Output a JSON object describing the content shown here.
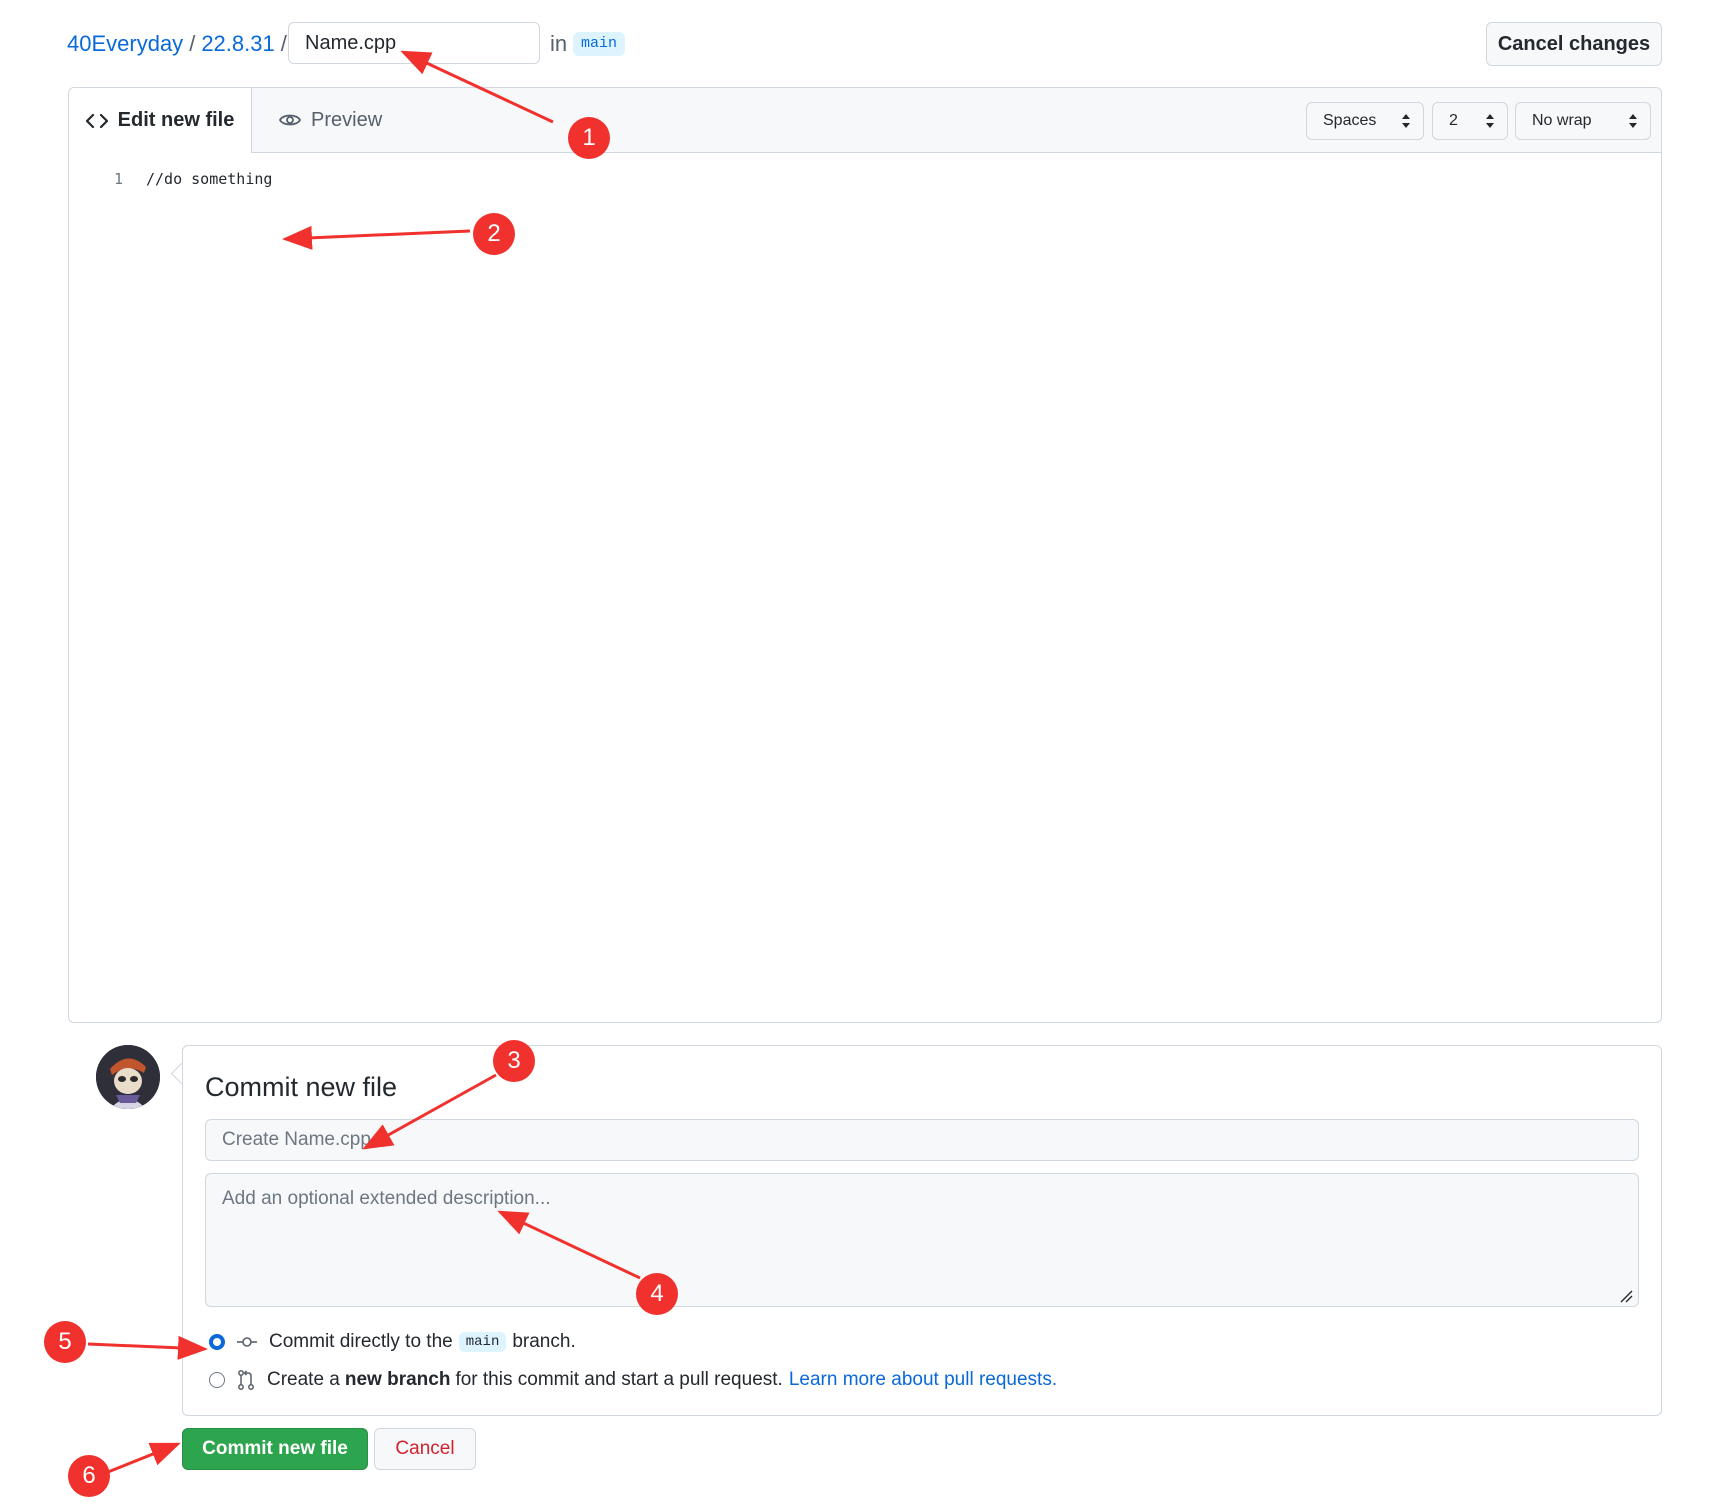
{
  "header": {
    "owner": "40Everyday",
    "separator": "/",
    "repo": "22.8.31",
    "file_name_value": "Name.cpp",
    "in_label": "in",
    "branch": "main",
    "cancel_changes_label": "Cancel changes"
  },
  "editor": {
    "tabs": [
      {
        "label": "Edit new file",
        "icon": "code-icon",
        "active": true
      },
      {
        "label": "Preview",
        "icon": "eye-icon",
        "active": false
      }
    ],
    "indent_mode": "Spaces",
    "indent_size": "2",
    "wrap_mode": "No wrap",
    "lines": [
      {
        "number": "1",
        "text": "//do something"
      }
    ]
  },
  "commit": {
    "title": "Commit new file",
    "message_placeholder": "Create Name.cpp",
    "description_placeholder": "Add an optional extended description...",
    "option_direct": {
      "prefix": "Commit directly to the",
      "branch": "main",
      "suffix": "branch.",
      "selected": true
    },
    "option_branch": {
      "prefix": "Create a",
      "bold": "new branch",
      "suffix": "for this commit and start a pull request.",
      "link": "Learn more about pull requests.",
      "selected": false
    },
    "submit_label": "Commit new file",
    "cancel_label": "Cancel"
  },
  "annotations": [
    "1",
    "2",
    "3",
    "4",
    "5",
    "6"
  ],
  "colors": {
    "link": "#0969da",
    "primary_button": "#2da44e",
    "danger_text": "#cf222e",
    "annotation": "#f0312d",
    "branch_chip_bg": "#ddf4ff"
  }
}
